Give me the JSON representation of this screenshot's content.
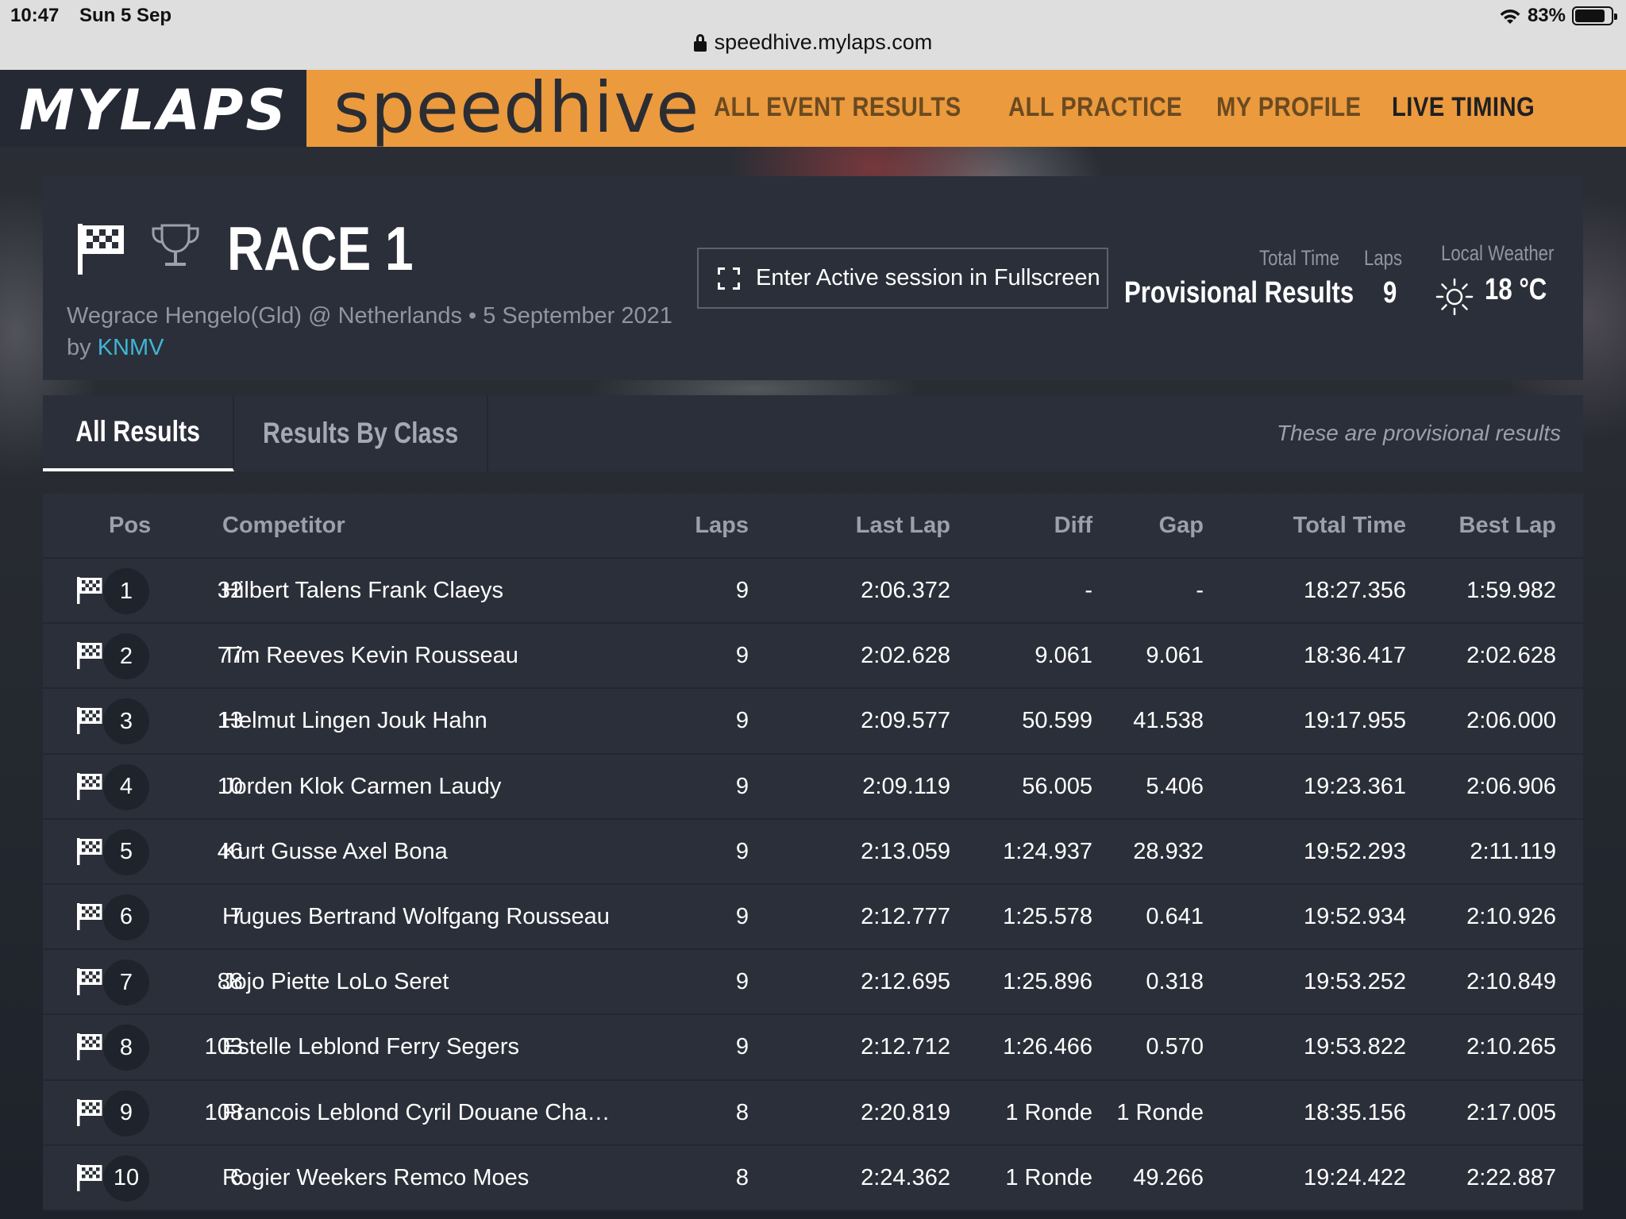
{
  "status_bar": {
    "time": "10:47",
    "date": "Sun 5 Sep",
    "battery": "83%",
    "battery_level": 0.83,
    "url": "speedhive.mylaps.com"
  },
  "header": {
    "brand": "MYLAPS",
    "product": "speedhive",
    "nav": [
      "ALL EVENT RESULTS",
      "ALL PRACTICE",
      "MY PROFILE",
      "LIVE TIMING"
    ],
    "active_nav": "LIVE TIMING",
    "accent_color": "#ec9a3e"
  },
  "session": {
    "title": "RACE 1",
    "event_line": "Wegrace Hengelo(Gld) @ Netherlands • 5 September 2021",
    "by_prefix": "by",
    "organizer": "KNMV",
    "fullscreen_label": "Enter Active session in Fullscreen",
    "total_time_label": "Total Time",
    "total_time_value": "Provisional Results",
    "laps_label": "Laps",
    "laps_value": "9",
    "weather_label": "Local Weather",
    "weather_value": "18 °C",
    "weather_icon": "sun-icon"
  },
  "tabs": {
    "all": "All Results",
    "by_class": "Results By Class",
    "note": "These are provisional results"
  },
  "table": {
    "headers": {
      "pos": "Pos",
      "competitor": "Competitor",
      "laps": "Laps",
      "last_lap": "Last Lap",
      "diff": "Diff",
      "gap": "Gap",
      "total_time": "Total Time",
      "best_lap": "Best Lap"
    },
    "rows": [
      {
        "pos": "1",
        "num": "32",
        "name": "Hilbert Talens Frank Claeys",
        "laps": "9",
        "last_lap": "2:06.372",
        "diff": "-",
        "gap": "-",
        "total": "18:27.356",
        "best": "1:59.982"
      },
      {
        "pos": "2",
        "num": "77",
        "name": "Tim Reeves Kevin Rousseau",
        "laps": "9",
        "last_lap": "2:02.628",
        "diff": "9.061",
        "gap": "9.061",
        "total": "18:36.417",
        "best": "2:02.628"
      },
      {
        "pos": "3",
        "num": "13",
        "name": "Helmut Lingen Jouk Hahn",
        "laps": "9",
        "last_lap": "2:09.577",
        "diff": "50.599",
        "gap": "41.538",
        "total": "19:17.955",
        "best": "2:06.000"
      },
      {
        "pos": "4",
        "num": "10",
        "name": "Jorden Klok Carmen Laudy",
        "laps": "9",
        "last_lap": "2:09.119",
        "diff": "56.005",
        "gap": "5.406",
        "total": "19:23.361",
        "best": "2:06.906"
      },
      {
        "pos": "5",
        "num": "46",
        "name": "Kurt Gusse Axel Bona",
        "laps": "9",
        "last_lap": "2:13.059",
        "diff": "1:24.937",
        "gap": "28.932",
        "total": "19:52.293",
        "best": "2:11.119"
      },
      {
        "pos": "6",
        "num": "7",
        "name": "Hugues Bertrand Wolfgang Rousseau",
        "laps": "9",
        "last_lap": "2:12.777",
        "diff": "1:25.578",
        "gap": "0.641",
        "total": "19:52.934",
        "best": "2:10.926"
      },
      {
        "pos": "7",
        "num": "88",
        "name": "Jojo Piette LoLo Seret",
        "laps": "9",
        "last_lap": "2:12.695",
        "diff": "1:25.896",
        "gap": "0.318",
        "total": "19:53.252",
        "best": "2:10.849"
      },
      {
        "pos": "8",
        "num": "103",
        "name": "Estelle Leblond Ferry Segers",
        "laps": "9",
        "last_lap": "2:12.712",
        "diff": "1:26.466",
        "gap": "0.570",
        "total": "19:53.822",
        "best": "2:10.265"
      },
      {
        "pos": "9",
        "num": "108",
        "name": "Francois Leblond Cyril Douane Cha…",
        "laps": "8",
        "last_lap": "2:20.819",
        "diff": "1 Ronde",
        "gap": "1 Ronde",
        "total": "18:35.156",
        "best": "2:17.005"
      },
      {
        "pos": "10",
        "num": "6",
        "name": "Rogier Weekers Remco Moes",
        "laps": "8",
        "last_lap": "2:24.362",
        "diff": "1 Ronde",
        "gap": "49.266",
        "total": "19:24.422",
        "best": "2:22.887"
      }
    ]
  }
}
